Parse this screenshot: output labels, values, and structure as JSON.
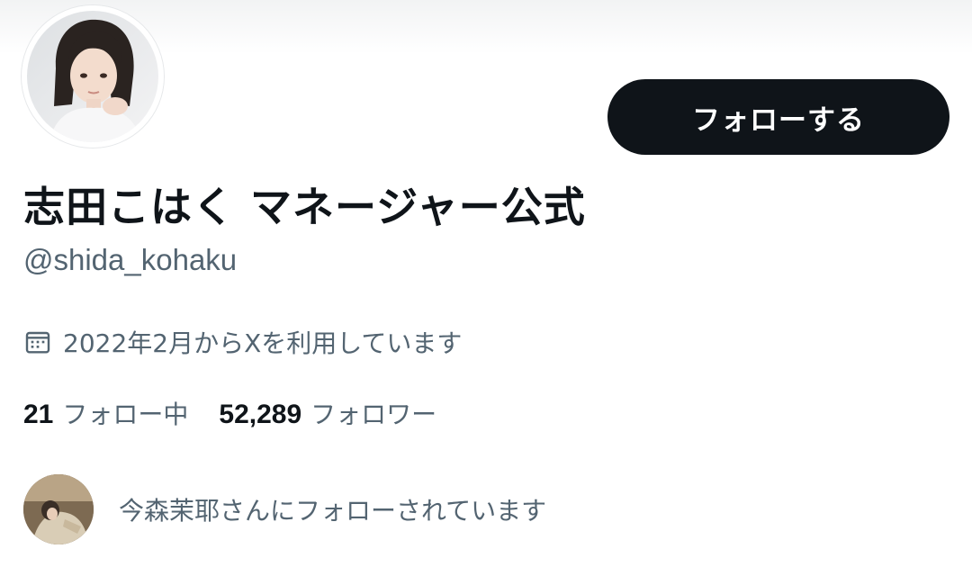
{
  "profile": {
    "display_name": "志田こはく マネージャー公式",
    "handle": "@shida_kohaku",
    "follow_button_label": "フォローする",
    "joined_text": "2022年2月からXを利用しています",
    "avatar_icon": "profile-photo",
    "calendar_icon": "calendar-icon"
  },
  "stats": {
    "following_count": "21",
    "following_label": "フォロー中",
    "followers_count": "52,289",
    "followers_label": "フォロワー"
  },
  "followed_by": {
    "text": "今森茉耶さんにフォローされています"
  },
  "colors": {
    "text_primary": "#0f1419",
    "text_secondary": "#536471",
    "button_bg": "#0f1419",
    "button_text": "#ffffff"
  }
}
